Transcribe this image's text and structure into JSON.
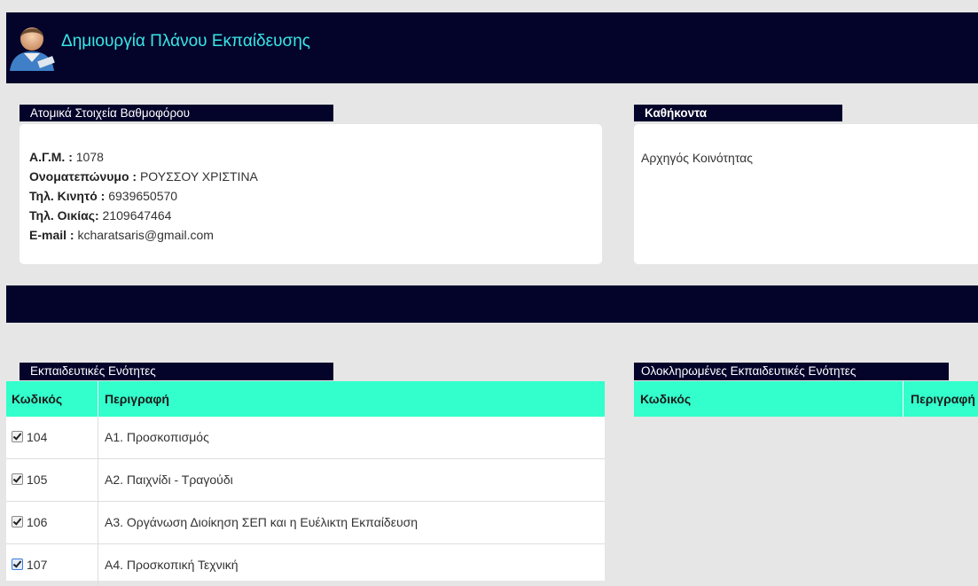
{
  "header": {
    "title": "Δημιουργία Πλάνου Εκπαίδευσης"
  },
  "personal": {
    "section_title": "Ατομικά Στοιχεία Βαθμοφόρου",
    "fields": [
      {
        "label": "Α.Γ.Μ. :",
        "value": " 1078"
      },
      {
        "label": "Ονοματεπώνυμο :",
        "value": " ΡΟΥΣΣΟΥ ΧΡΙΣΤΙΝΑ"
      },
      {
        "label": "Τηλ. Κινητό :",
        "value": " 6939650570"
      },
      {
        "label": "Τηλ. Οικίας:",
        "value": " 2109647464"
      },
      {
        "label": "E-mail :",
        "value": " kcharatsaris@gmail.com"
      }
    ]
  },
  "duties": {
    "section_title": "Καθήκοντα",
    "text": "Αρχηγός Κοινότητας"
  },
  "units": {
    "section_title": "Εκπαιδευτικές Ενότητες",
    "columns": {
      "code": "Κωδικός",
      "description": "Περιγραφή"
    },
    "rows": [
      {
        "code": "104",
        "description": "Α1. Προσκοπισμός",
        "checked": true
      },
      {
        "code": "105",
        "description": "Α2. Παιχνίδι - Τραγούδι",
        "checked": true
      },
      {
        "code": "106",
        "description": "Α3. Οργάνωση Διοίκηση ΣΕΠ και η Ευέλικτη Εκπαίδευση",
        "checked": true
      },
      {
        "code": "107",
        "description": "Α4. Προσκοπική Τεχνική",
        "checked": true
      }
    ]
  },
  "completed": {
    "section_title": "Ολοκληρωμένες Εκπαιδευτικές Ενότητες",
    "columns": {
      "code": "Κωδικός",
      "description": "Περιγραφή"
    }
  },
  "colors": {
    "navy": "#04042b",
    "accent": "#33ffcc",
    "title": "#38e6e6"
  },
  "icons": {
    "avatar": "user-avatar-icon",
    "checkbox": "checkbox-checked-icon"
  }
}
